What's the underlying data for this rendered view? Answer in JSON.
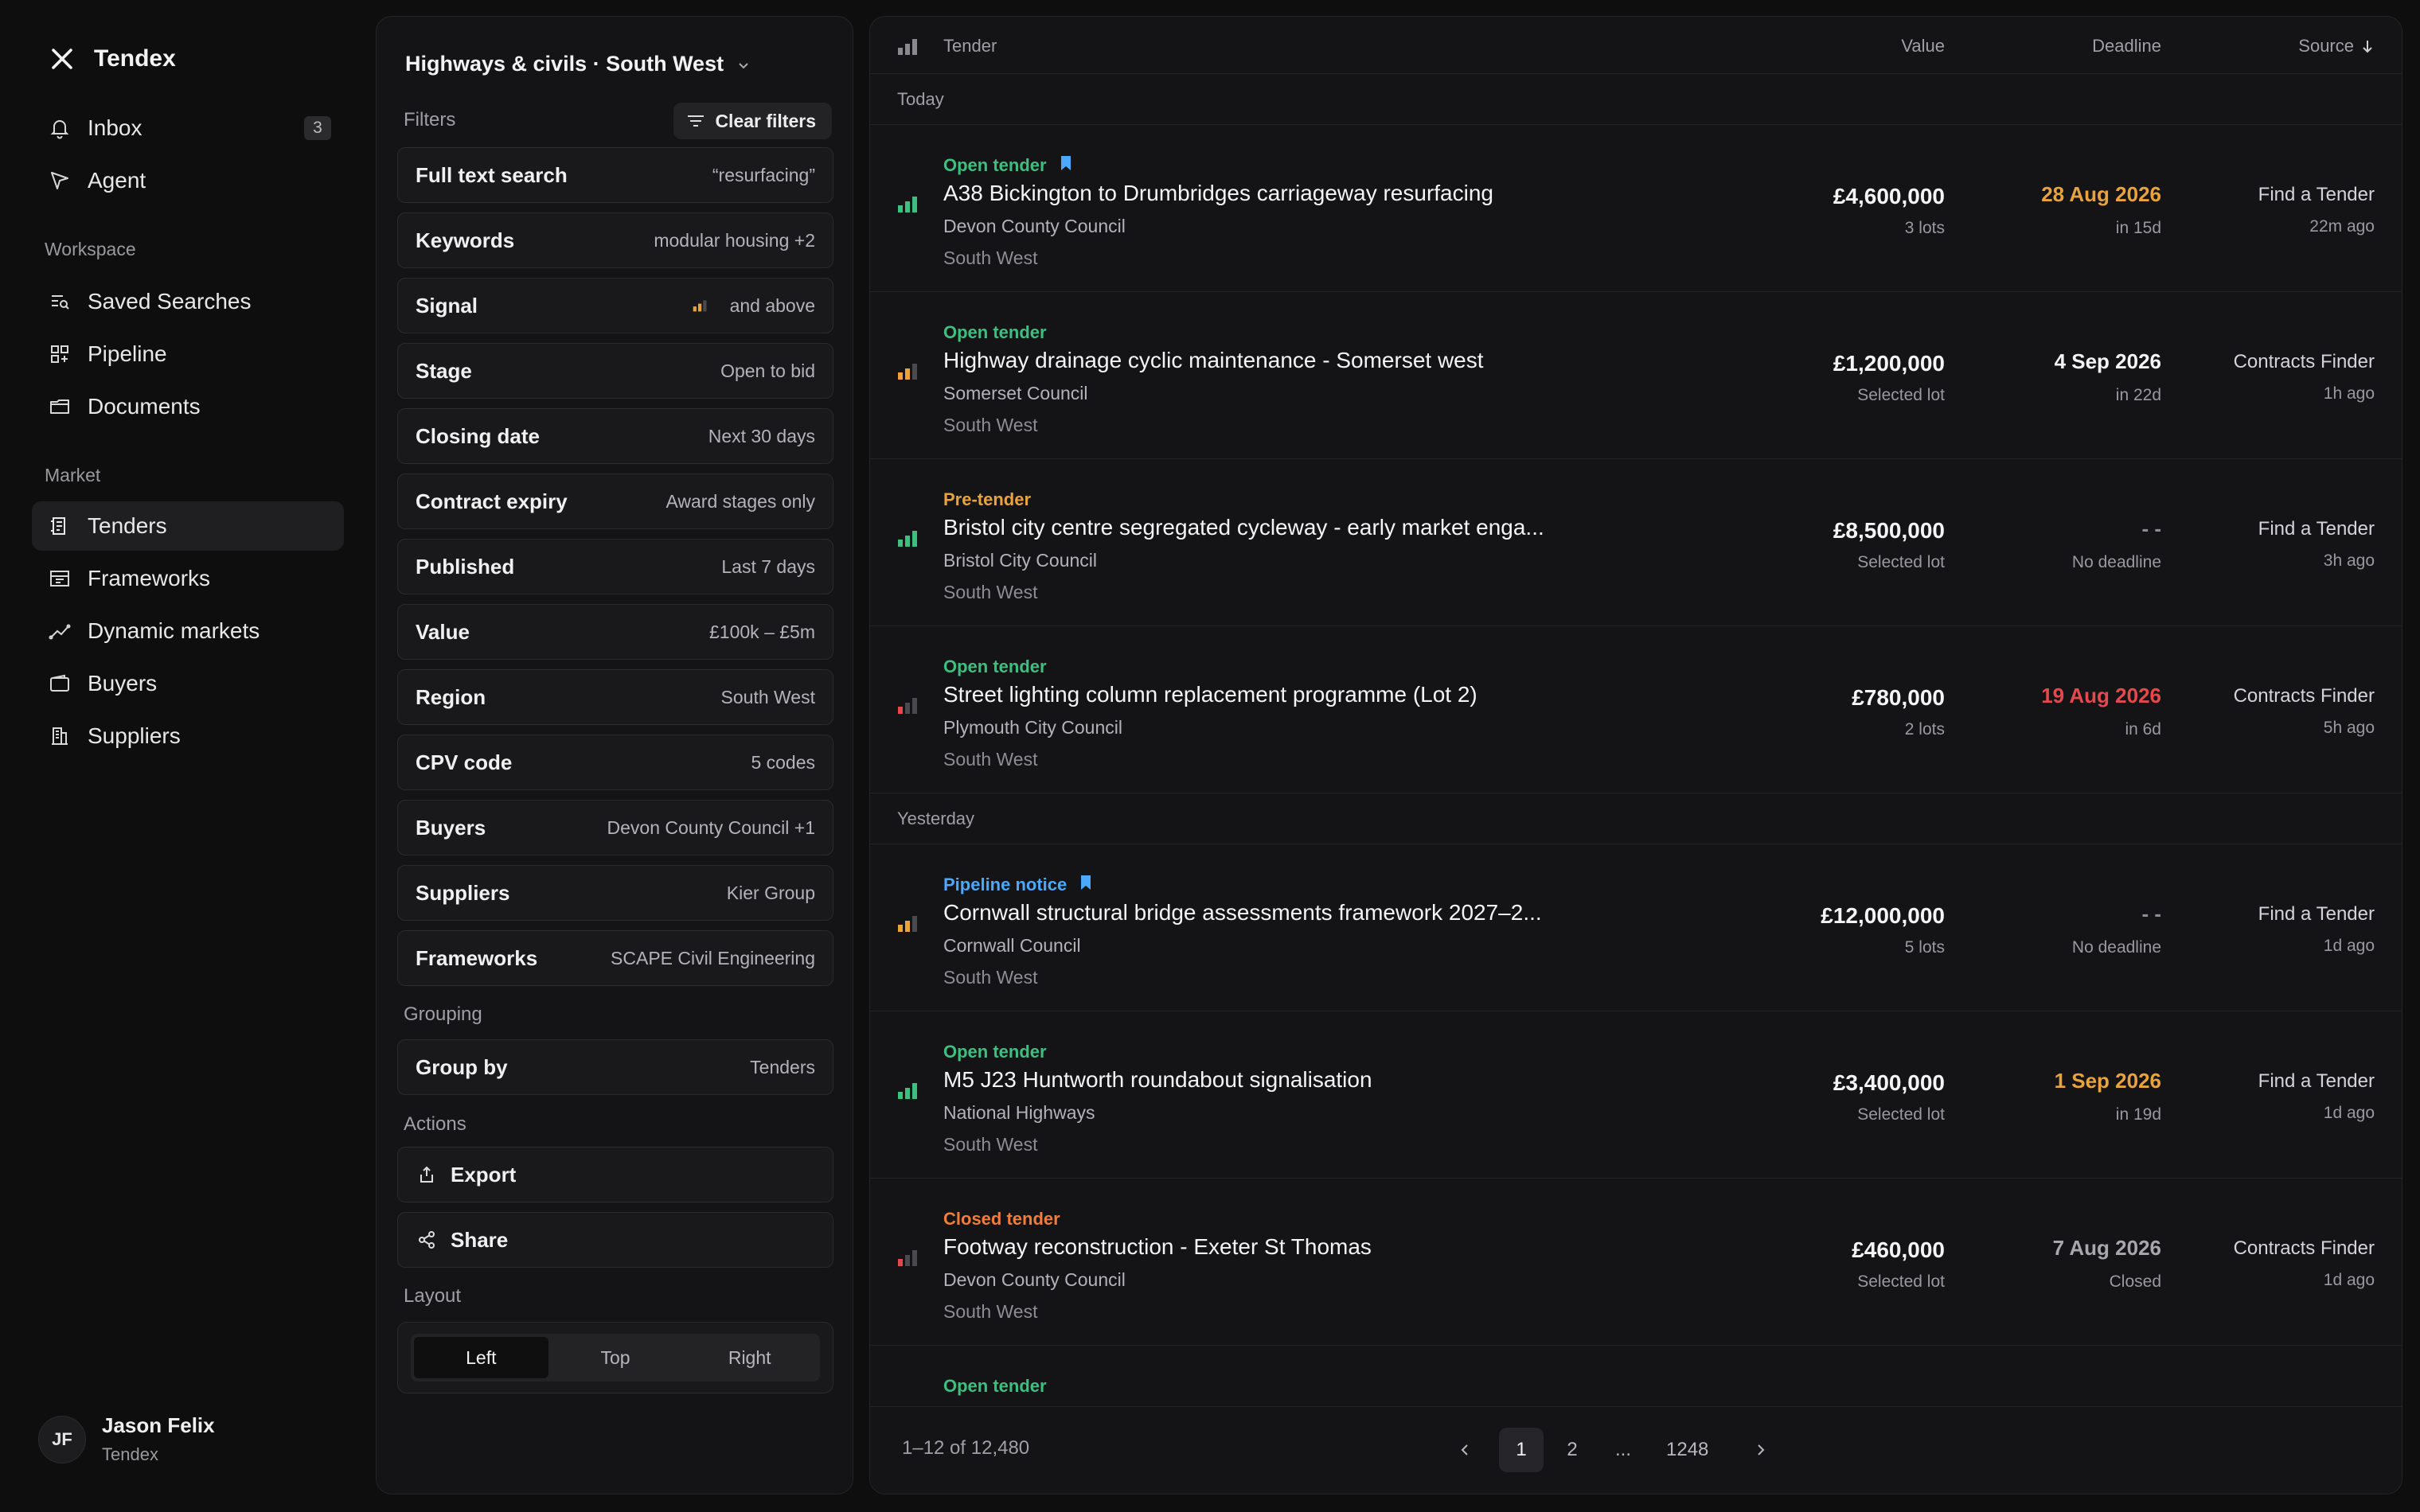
{
  "colors": {
    "green": "#3fbf7f",
    "amber": "#e8a33d",
    "red": "#e5484d",
    "blue": "#4aa8ff",
    "orange": "#f27c3a",
    "muted_bar": "#4a4a4e"
  },
  "sidebar": {
    "brand": "Tendex",
    "nav": [
      {
        "label": "Inbox",
        "icon": "bell-icon",
        "badge": "3"
      },
      {
        "label": "Agent",
        "icon": "send-icon"
      }
    ],
    "workspace_label": "Workspace",
    "workspace": [
      {
        "label": "Saved Searches",
        "icon": "saved-search-icon"
      },
      {
        "label": "Pipeline",
        "icon": "pipeline-icon"
      },
      {
        "label": "Documents",
        "icon": "folder-icon"
      }
    ],
    "market_label": "Market",
    "market": [
      {
        "label": "Tenders",
        "icon": "tenders-icon",
        "active": true
      },
      {
        "label": "Frameworks",
        "icon": "frameworks-icon"
      },
      {
        "label": "Dynamic markets",
        "icon": "trend-icon"
      },
      {
        "label": "Buyers",
        "icon": "wallet-icon"
      },
      {
        "label": "Suppliers",
        "icon": "building-icon"
      }
    ],
    "user": {
      "initials": "JF",
      "name": "Jason Felix",
      "org": "Tendex"
    }
  },
  "filters": {
    "title": "Highways & civils · South West",
    "filters_label": "Filters",
    "clear_label": "Clear filters",
    "rows": [
      {
        "label": "Full text search",
        "value": "“resurfacing”"
      },
      {
        "label": "Keywords",
        "value": "modular housing +2"
      },
      {
        "label": "Signal",
        "value": "and above",
        "signal_level": 2
      },
      {
        "label": "Stage",
        "value": "Open to bid"
      },
      {
        "label": "Closing date",
        "value": "Next 30 days"
      },
      {
        "label": "Contract expiry",
        "value": "Award stages only"
      },
      {
        "label": "Published",
        "value": "Last 7 days"
      },
      {
        "label": "Value",
        "value": "£100k – £5m"
      },
      {
        "label": "Region",
        "value": "South West"
      },
      {
        "label": "CPV code",
        "value": "5 codes"
      },
      {
        "label": "Buyers",
        "value": "Devon County Council +1"
      },
      {
        "label": "Suppliers",
        "value": "Kier Group"
      },
      {
        "label": "Frameworks",
        "value": "SCAPE Civil Engineering"
      }
    ],
    "grouping_label": "Grouping",
    "group_by": {
      "label": "Group by",
      "value": "Tenders"
    },
    "actions_label": "Actions",
    "actions": [
      {
        "label": "Export",
        "icon": "export-icon"
      },
      {
        "label": "Share",
        "icon": "share-icon"
      }
    ],
    "layout_label": "Layout",
    "layout_options": [
      "Left",
      "Top",
      "Right"
    ],
    "layout_selected": "Left"
  },
  "results": {
    "headers": {
      "tender": "Tender",
      "value": "Value",
      "deadline": "Deadline",
      "source": "Source"
    },
    "groups": [
      {
        "label": "Today",
        "rows": [
          {
            "status": "Open tender",
            "status_color": "green",
            "bookmarked": true,
            "signal": 3,
            "signal_color": "green",
            "title": "A38 Bickington to Drumbridges carriageway resurfacing",
            "buyer": "Devon County Council",
            "region": "South West",
            "value": "£4,600,000",
            "lots": "3 lots",
            "deadline": "28 Aug 2026",
            "deadline_color": "amber",
            "deadline_sub": "in 15d",
            "source": "Find a Tender",
            "ago": "22m ago"
          },
          {
            "status": "Open tender",
            "status_color": "green",
            "bookmarked": false,
            "signal": 2,
            "signal_color": "amber",
            "title": "Highway drainage cyclic maintenance - Somerset west",
            "buyer": "Somerset Council",
            "region": "South West",
            "value": "£1,200,000",
            "lots": "Selected lot",
            "deadline": "4 Sep 2026",
            "deadline_color": "white",
            "deadline_sub": "in 22d",
            "source": "Contracts Finder",
            "ago": "1h ago"
          },
          {
            "status": "Pre-tender",
            "status_color": "amber",
            "bookmarked": false,
            "signal": 3,
            "signal_color": "green",
            "title": "Bristol city centre segregated cycleway - early market enga...",
            "buyer": "Bristol City Council",
            "region": "South West",
            "value": "£8,500,000",
            "lots": "Selected lot",
            "deadline": "- -",
            "deadline_color": "muted",
            "deadline_sub": "No deadline",
            "source": "Find a Tender",
            "ago": "3h ago"
          },
          {
            "status": "Open tender",
            "status_color": "green",
            "bookmarked": false,
            "signal": 1,
            "signal_color": "red",
            "title": "Street lighting column replacement programme (Lot 2)",
            "buyer": "Plymouth City Council",
            "region": "South West",
            "value": "£780,000",
            "lots": "2 lots",
            "deadline": "19 Aug 2026",
            "deadline_color": "red",
            "deadline_sub": "in 6d",
            "source": "Contracts Finder",
            "ago": "5h ago"
          }
        ]
      },
      {
        "label": "Yesterday",
        "rows": [
          {
            "status": "Pipeline notice",
            "status_color": "blue",
            "bookmarked": true,
            "signal": 2,
            "signal_color": "amber",
            "title": "Cornwall structural bridge assessments framework 2027–2...",
            "buyer": "Cornwall Council",
            "region": "South West",
            "value": "£12,000,000",
            "lots": "5 lots",
            "deadline": "- -",
            "deadline_color": "muted",
            "deadline_sub": "No deadline",
            "source": "Find a Tender",
            "ago": "1d ago"
          },
          {
            "status": "Open tender",
            "status_color": "green",
            "bookmarked": false,
            "signal": 3,
            "signal_color": "green",
            "title": "M5 J23 Huntworth roundabout signalisation",
            "buyer": "National Highways",
            "region": "South West",
            "value": "£3,400,000",
            "lots": "Selected lot",
            "deadline": "1 Sep 2026",
            "deadline_color": "amber",
            "deadline_sub": "in 19d",
            "source": "Find a Tender",
            "ago": "1d ago"
          },
          {
            "status": "Closed tender",
            "status_color": "orange",
            "bookmarked": false,
            "signal": 1,
            "signal_color": "red",
            "title": "Footway reconstruction - Exeter St Thomas",
            "buyer": "Devon County Council",
            "region": "South West",
            "value": "£460,000",
            "lots": "Selected lot",
            "deadline": "7 Aug 2026",
            "deadline_color": "grey",
            "deadline_sub": "Closed",
            "source": "Contracts Finder",
            "ago": "1d ago"
          },
          {
            "status": "Open tender",
            "status_color": "green",
            "bookmarked": false,
            "signal": 0,
            "signal_color": "green",
            "title": "",
            "buyer": "",
            "region": "",
            "value": "",
            "lots": "",
            "deadline": "",
            "deadline_color": "white",
            "deadline_sub": "",
            "source": "",
            "ago": ""
          }
        ]
      }
    ],
    "pagination": {
      "range": "1–12 of 12,480",
      "pages": [
        "1",
        "2",
        "...",
        "1248"
      ],
      "current": "1"
    }
  }
}
